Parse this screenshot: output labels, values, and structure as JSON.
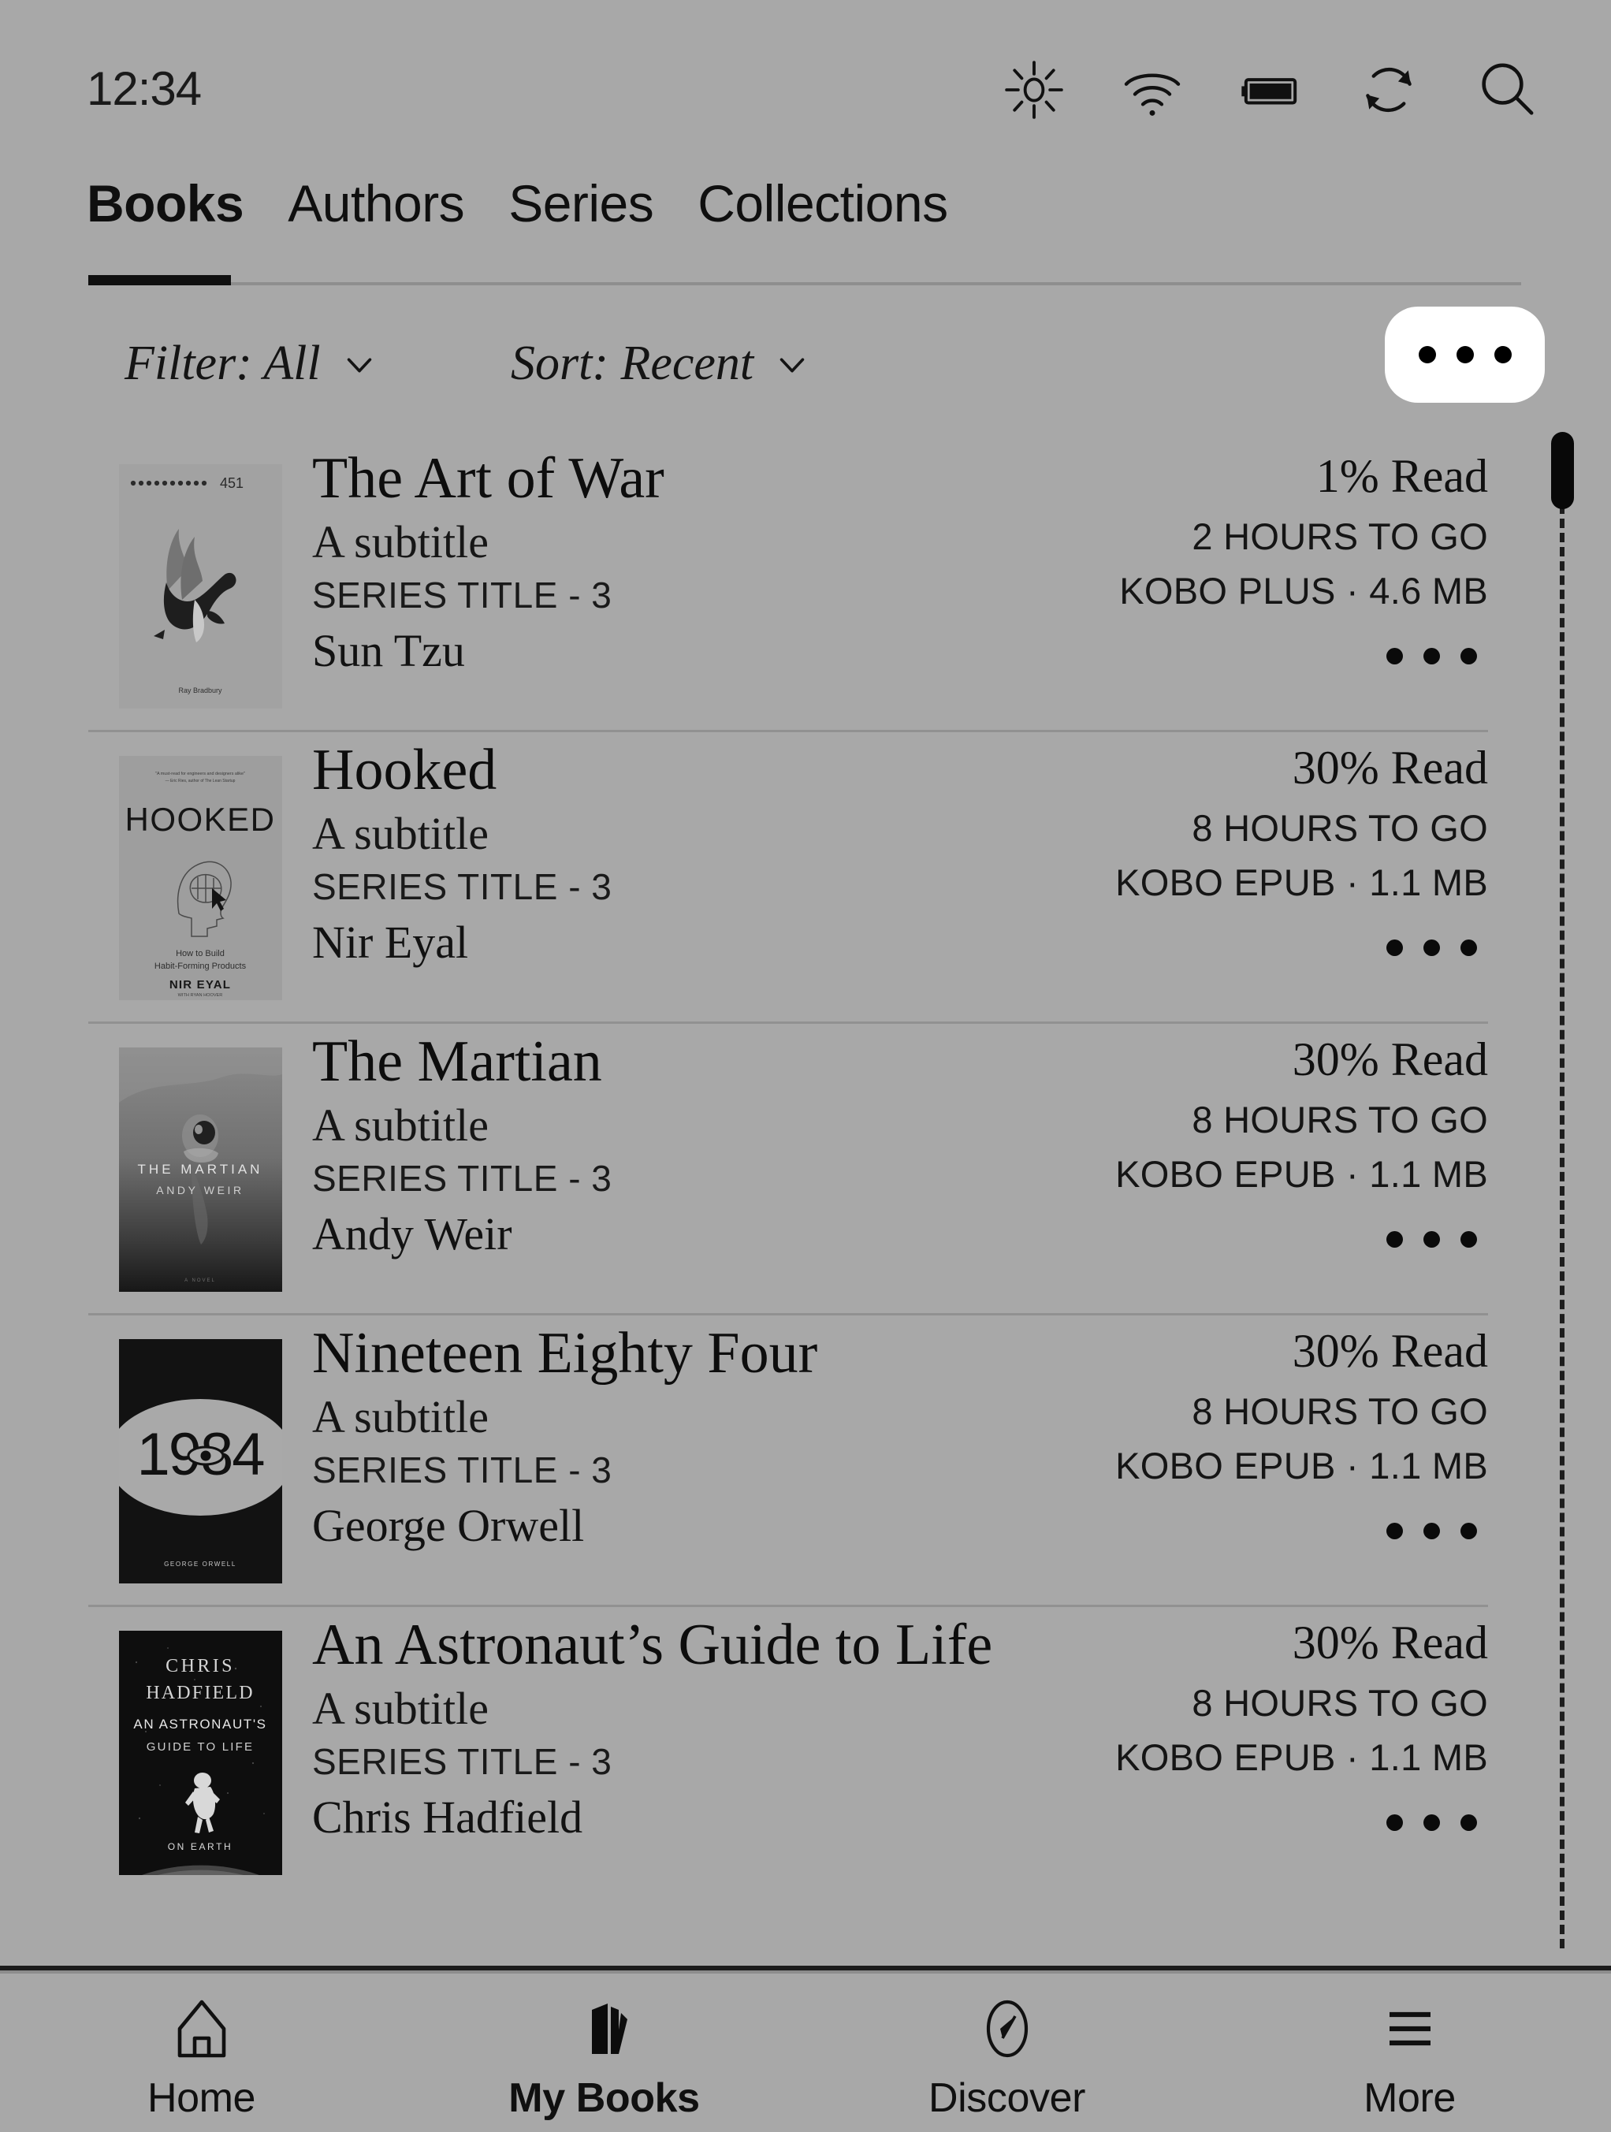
{
  "statusbar": {
    "clock": "12:34",
    "icons": [
      {
        "name": "brightness-icon",
        "label": "Brightness"
      },
      {
        "name": "wifi-icon",
        "label": "Wi-Fi"
      },
      {
        "name": "battery-icon",
        "label": "Battery"
      },
      {
        "name": "sync-icon",
        "label": "Sync"
      },
      {
        "name": "search-icon",
        "label": "Search"
      }
    ]
  },
  "tabs": [
    {
      "label": "Books",
      "active": true
    },
    {
      "label": "Authors",
      "active": false
    },
    {
      "label": "Series",
      "active": false
    },
    {
      "label": "Collections",
      "active": false
    }
  ],
  "controls": {
    "filter": "Filter: All",
    "sort": "Sort: Recent",
    "filter_chevron": "chevron-down-icon",
    "sort_chevron": "chevron-down-icon",
    "overflow_label": "•••"
  },
  "books": [
    {
      "title": "The Art of War",
      "subtitle": "A subtitle",
      "series": "SERIES TITLE - 3",
      "author": "Sun Tzu",
      "progress": "1% Read",
      "time_left": "2 HOURS TO GO",
      "format": "KOBO PLUS · 4.6 MB",
      "cover": "fahrenheit"
    },
    {
      "title": "Hooked",
      "subtitle": "A subtitle",
      "series": "SERIES TITLE - 3",
      "author": "Nir Eyal",
      "progress": "30% Read",
      "time_left": "8 HOURS TO GO",
      "format": "KOBO EPUB · 1.1 MB",
      "cover": "hooked"
    },
    {
      "title": "The Martian",
      "subtitle": "A subtitle",
      "series": "SERIES TITLE - 3",
      "author": "Andy Weir",
      "progress": "30% Read",
      "time_left": "8 HOURS TO GO",
      "format": "KOBO EPUB · 1.1 MB",
      "cover": "martian"
    },
    {
      "title": "Nineteen Eighty Four",
      "subtitle": "A subtitle",
      "series": "SERIES TITLE - 3",
      "author": "George Orwell",
      "progress": "30% Read",
      "time_left": "8 HOURS TO GO",
      "format": "KOBO EPUB · 1.1 MB",
      "cover": "nineteen84"
    },
    {
      "title": "An Astronaut’s Guide to Life",
      "subtitle": "A subtitle",
      "series": "SERIES TITLE - 3",
      "author": "Chris Hadfield",
      "progress": "30% Read",
      "time_left": "8 HOURS TO GO",
      "format": "KOBO EPUB · 1.1 MB",
      "cover": "astronaut"
    }
  ],
  "cover_art_text": {
    "hooked": {
      "title": "HOOKED",
      "line1": "How to Build",
      "line2": "Habit-Forming Products",
      "author": "NIR EYAL"
    },
    "martian": {
      "title": "THE MARTIAN",
      "author": "ANDY WEIR"
    },
    "nineteen84": {
      "title": "1984",
      "author": "GEORGE ORWELL"
    },
    "astronaut": {
      "author": "CHRIS HADFIELD",
      "line1": "AN ASTRONAUT'S",
      "line2": "GUIDE TO LIFE",
      "line3": "ON EARTH"
    },
    "fahrenheit": {
      "number": "451",
      "author": "Ray Bradbury"
    }
  },
  "bottom_nav": [
    {
      "label": "Home",
      "icon": "home-icon",
      "active": false
    },
    {
      "label": "My Books",
      "icon": "books-icon",
      "active": true
    },
    {
      "label": "Discover",
      "icon": "compass-icon",
      "active": false
    },
    {
      "label": "More",
      "icon": "hamburger-icon",
      "active": false
    }
  ],
  "colors": {
    "background": "#a8a8a8",
    "ink": "#101010",
    "divider": "#919191",
    "accent_white": "#ffffff"
  }
}
